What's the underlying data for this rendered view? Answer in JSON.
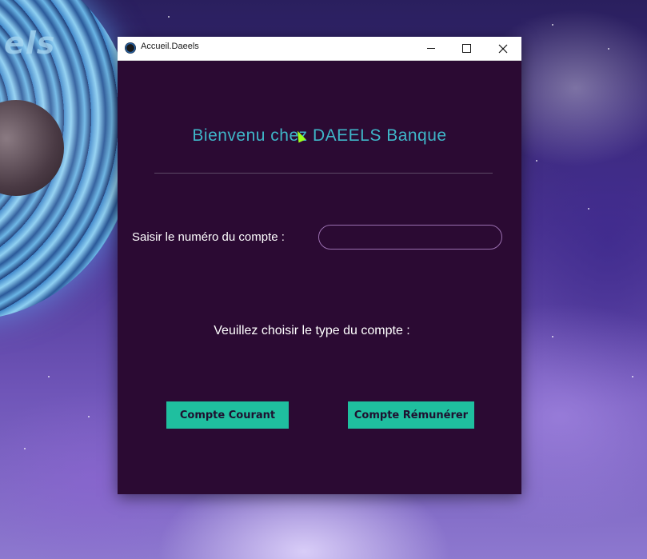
{
  "window": {
    "title": "Accueil.Daeels"
  },
  "main": {
    "heading": "Bienvenu chez DAEELS Banque",
    "account_label": "Saisir le numéro du compte :",
    "account_input_value": "",
    "type_label": "Veuillez choisir le type du compte :",
    "buttons": {
      "courant": "Compte Courant",
      "remunerer": "Compte Rémunérer"
    }
  },
  "wallpaper": {
    "brand_text": "els"
  },
  "colors": {
    "window_bg": "#2b0a33",
    "heading": "#3fb6c8",
    "button_bg": "#1fbf9f",
    "input_border": "#9a6fb0"
  },
  "icons": {
    "app": "app-icon",
    "minimize": "minimize-icon",
    "maximize": "maximize-icon",
    "close": "close-icon",
    "cursor": "mouse-cursor-icon"
  }
}
